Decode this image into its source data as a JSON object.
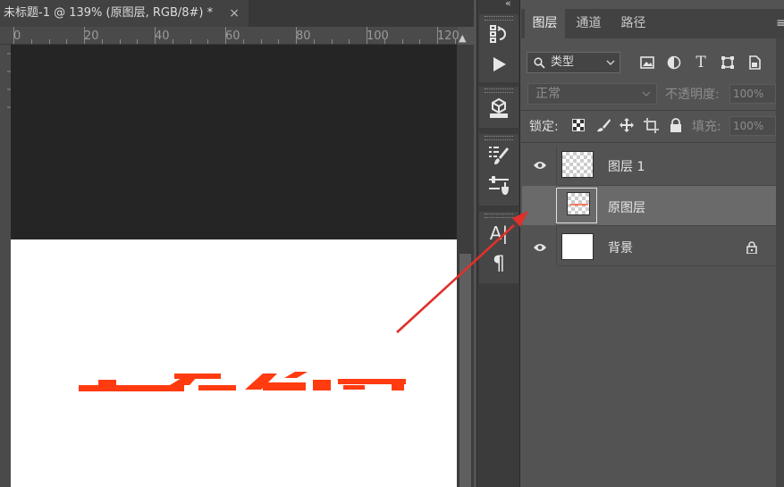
{
  "document": {
    "tab_title": "未标题-1 @ 139% (原图层, RGB/8#) *",
    "close_glyph": "×"
  },
  "ruler": {
    "labels": [
      "0",
      "20",
      "40",
      "60",
      "80",
      "100",
      "120"
    ]
  },
  "canvas": {
    "text_color": "#ff3b0f"
  },
  "tools": [
    {
      "name": "history-brush-icon"
    },
    {
      "name": "play-action-icon"
    },
    {
      "name": "3d-cube-icon"
    },
    {
      "name": "brush-presets-icon"
    },
    {
      "name": "adjust-sliders-icon"
    },
    {
      "name": "character-text-icon",
      "glyph": "A|"
    },
    {
      "name": "paragraph-icon",
      "glyph": "¶"
    }
  ],
  "panel": {
    "collapse_glyph": "«",
    "menu_glyph": "≡",
    "tabs": [
      {
        "label": "图层",
        "active": true
      },
      {
        "label": "通道",
        "active": false
      },
      {
        "label": "路径",
        "active": false
      }
    ],
    "filter": {
      "search_glyph": "🔍",
      "type_label": "类型",
      "icons": [
        "image-filter-icon",
        "adjustment-filter-icon",
        "type-filter-icon",
        "shape-filter-icon",
        "smart-object-filter-icon"
      ]
    },
    "blend_mode": "正常",
    "opacity_label": "不透明度:",
    "opacity_value": "100%",
    "lock_label": "锁定:",
    "fill_label": "填充:",
    "fill_value": "100%"
  },
  "layers": [
    {
      "name": "图层 1",
      "visible": true,
      "selected": false,
      "thumb": "transparent",
      "locked": false
    },
    {
      "name": "原图层",
      "visible": false,
      "selected": true,
      "thumb": "transparent-with-mark",
      "locked": false
    },
    {
      "name": "背景",
      "visible": true,
      "selected": false,
      "thumb": "white",
      "locked": true
    }
  ],
  "annotation": {
    "arrow_color": "#e0302a"
  }
}
